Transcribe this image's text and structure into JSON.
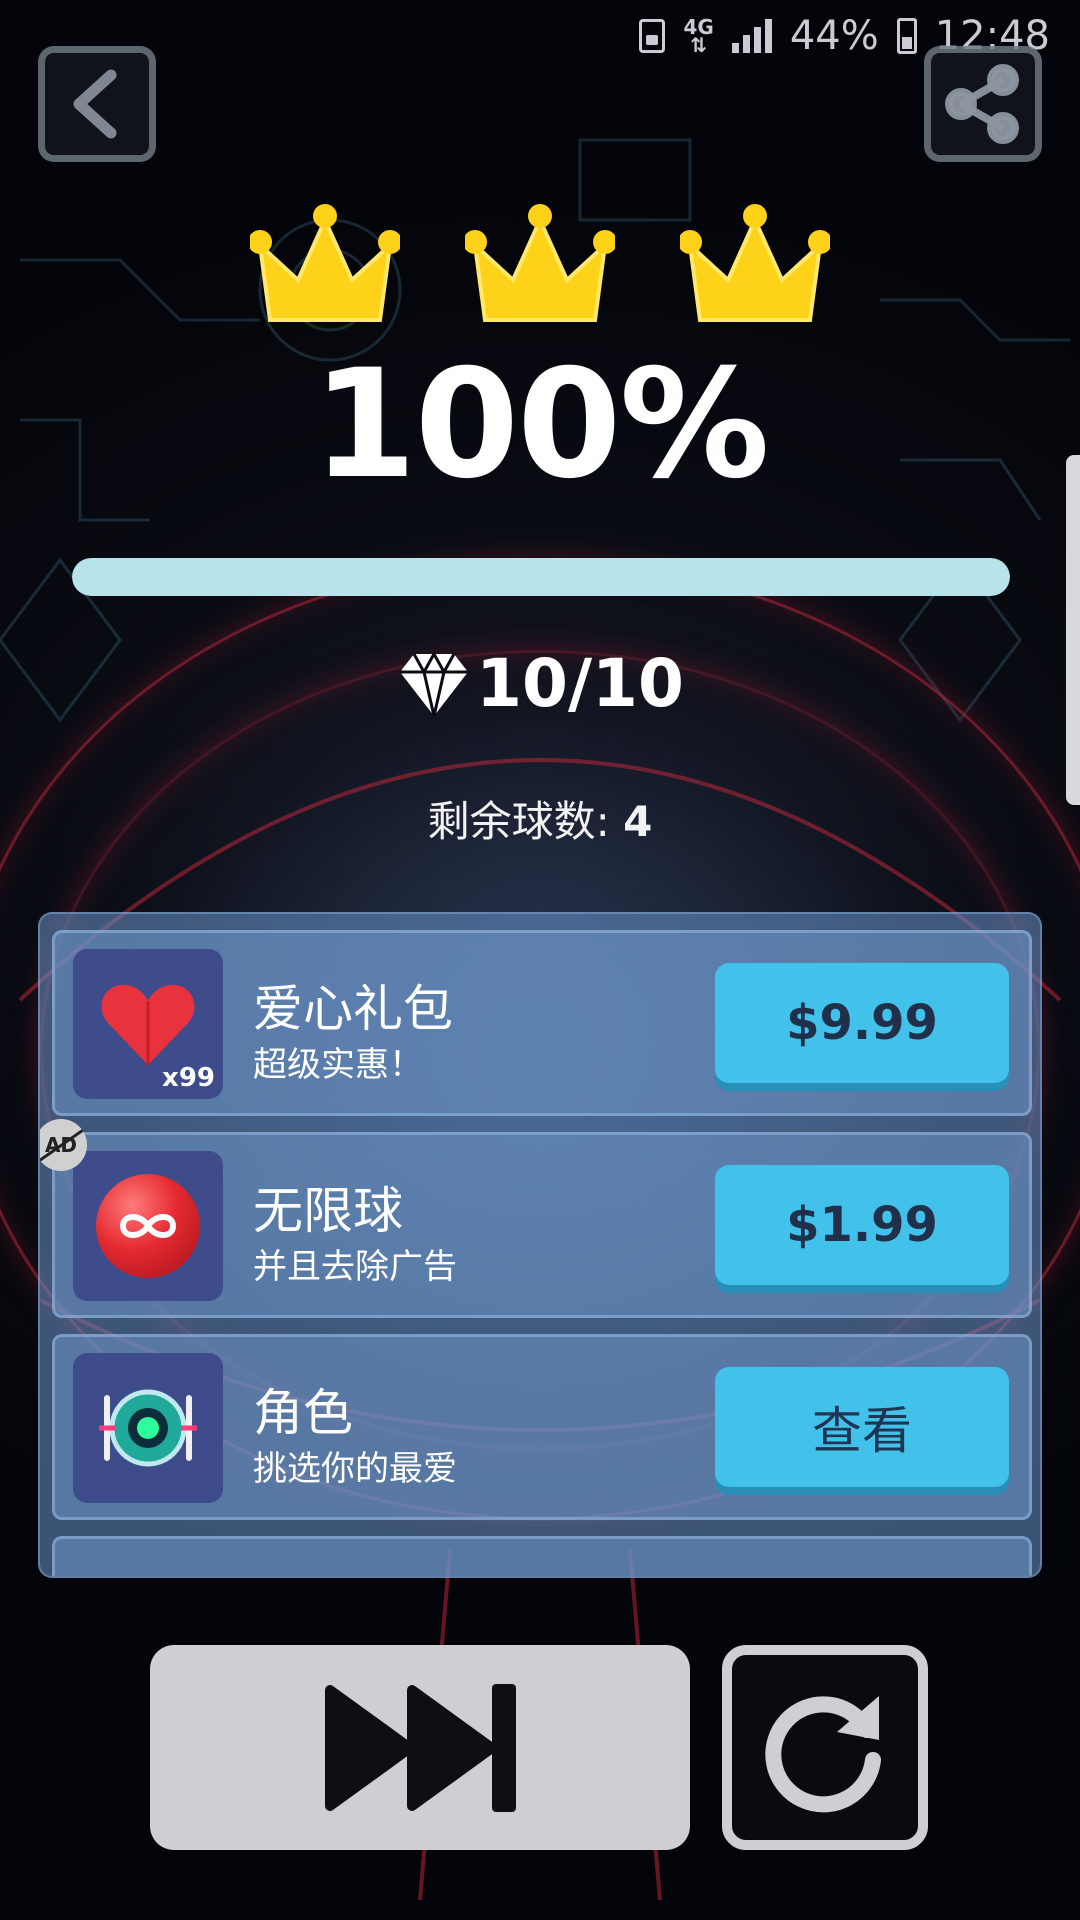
{
  "status_bar": {
    "network": "4G",
    "battery": "44%",
    "time": "12:48"
  },
  "result": {
    "crowns_earned": 3,
    "percent": "100%",
    "progress": 1.0,
    "gems": "10/10",
    "balls_left_label": "剩余球数:",
    "balls_left_value": "4"
  },
  "shop": {
    "items": [
      {
        "title": "爱心礼包",
        "subtitle": "超级实惠！",
        "badge": "x99",
        "button": "$9.99",
        "icon": "heart-icon"
      },
      {
        "title": "无限球",
        "subtitle": "并且去除广告",
        "badge": "AD",
        "button": "$1.99",
        "icon": "infinity-ball-icon"
      },
      {
        "title": "角色",
        "subtitle": "挑选你的最爱",
        "button": "查看",
        "icon": "robot-character-icon"
      }
    ]
  },
  "controls": {
    "back": "back-arrow-icon",
    "share": "share-icon",
    "next": "skip-forward-icon",
    "replay": "replay-icon"
  },
  "colors": {
    "button_blue": "#42c2ea",
    "progress_fill": "#b9e3ea",
    "crown_gold": "#ffd21a",
    "icon_tile": "#3e4c8c"
  }
}
